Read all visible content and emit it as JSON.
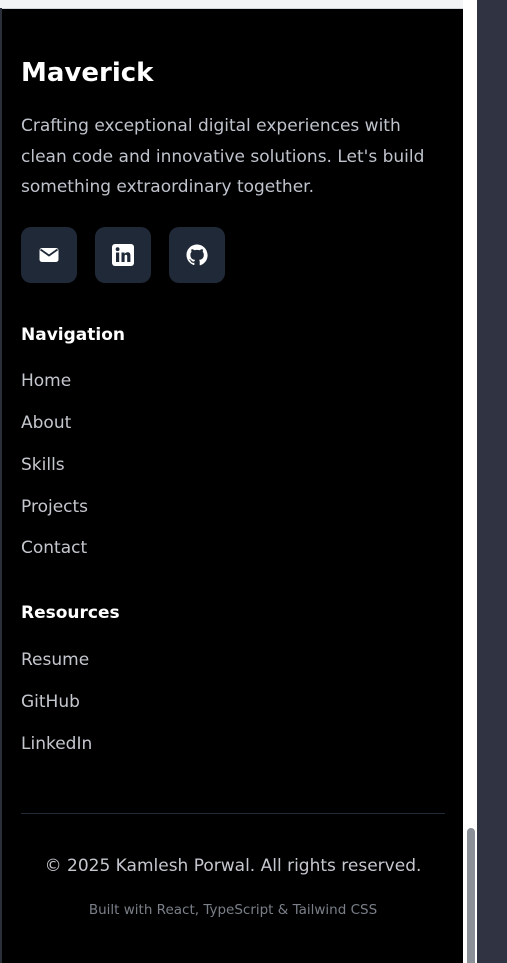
{
  "footer": {
    "brand": "Maverick",
    "tagline": "Crafting exceptional digital experiences with clean code and innovative solutions. Let's build something extraordinary together.",
    "social": [
      {
        "icon": "mail-icon",
        "label": "Email"
      },
      {
        "icon": "linkedin-icon",
        "label": "LinkedIn"
      },
      {
        "icon": "github-icon",
        "label": "GitHub"
      }
    ],
    "navigation": {
      "title": "Navigation",
      "links": [
        "Home",
        "About",
        "Skills",
        "Projects",
        "Contact"
      ]
    },
    "resources": {
      "title": "Resources",
      "links": [
        "Resume",
        "GitHub",
        "LinkedIn"
      ]
    },
    "copyright": "© 2025 Kamlesh Porwal. All rights reserved.",
    "built_with": "Built with React, TypeScript & Tailwind CSS"
  },
  "colors": {
    "background": "#000000",
    "social_button_bg": "#1f2937",
    "heading": "#ffffff",
    "body_text": "#c4c7ce",
    "muted_text": "#7a7f88",
    "divider": "#1f2937",
    "outer_bar": "#2f3342"
  }
}
